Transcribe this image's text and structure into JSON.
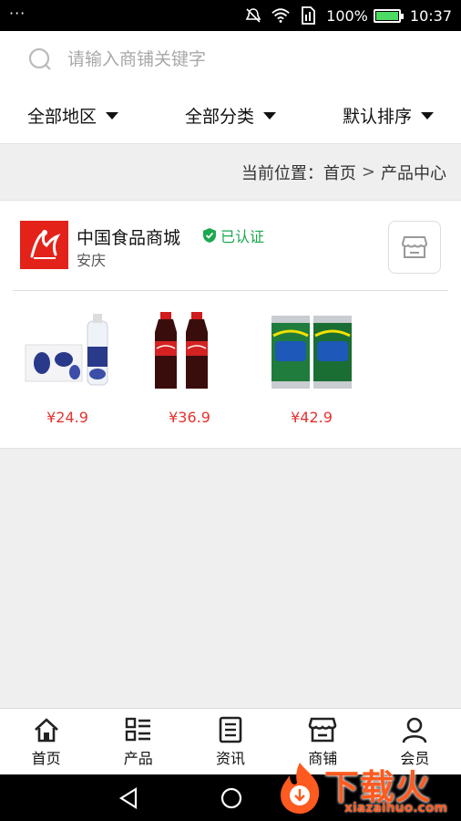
{
  "status_bar": {
    "menu_dots": "···",
    "battery": "100%",
    "time": "10:37"
  },
  "search": {
    "placeholder": "请输入商铺关键字"
  },
  "filters": [
    {
      "label": "全部地区"
    },
    {
      "label": "全部分类"
    },
    {
      "label": "默认排序"
    }
  ],
  "breadcrumb": {
    "prefix": "当前位置：",
    "home": "首页",
    "separator": ">",
    "current": "产品中心"
  },
  "shop": {
    "name": "中国食品商城",
    "verified_label": "已认证",
    "city": "安庆",
    "products": [
      {
        "price": "¥24.9",
        "image": "water-bottles-pack"
      },
      {
        "price": "¥36.9",
        "image": "cola-bottles"
      },
      {
        "price": "¥42.9",
        "image": "sprite-cans"
      }
    ]
  },
  "bottom_nav": [
    {
      "label": "首页",
      "icon": "home-icon"
    },
    {
      "label": "产品",
      "icon": "list-icon"
    },
    {
      "label": "资讯",
      "icon": "news-icon"
    },
    {
      "label": "商铺",
      "icon": "store-icon"
    },
    {
      "label": "会员",
      "icon": "user-icon"
    }
  ],
  "watermark": {
    "text": "下载火",
    "sub": "xiazaihuo.com"
  },
  "colors": {
    "price": "#e3342f",
    "verified": "#1ca84f",
    "logo_bg": "#e32219",
    "watermark": "#ff5a1f"
  }
}
